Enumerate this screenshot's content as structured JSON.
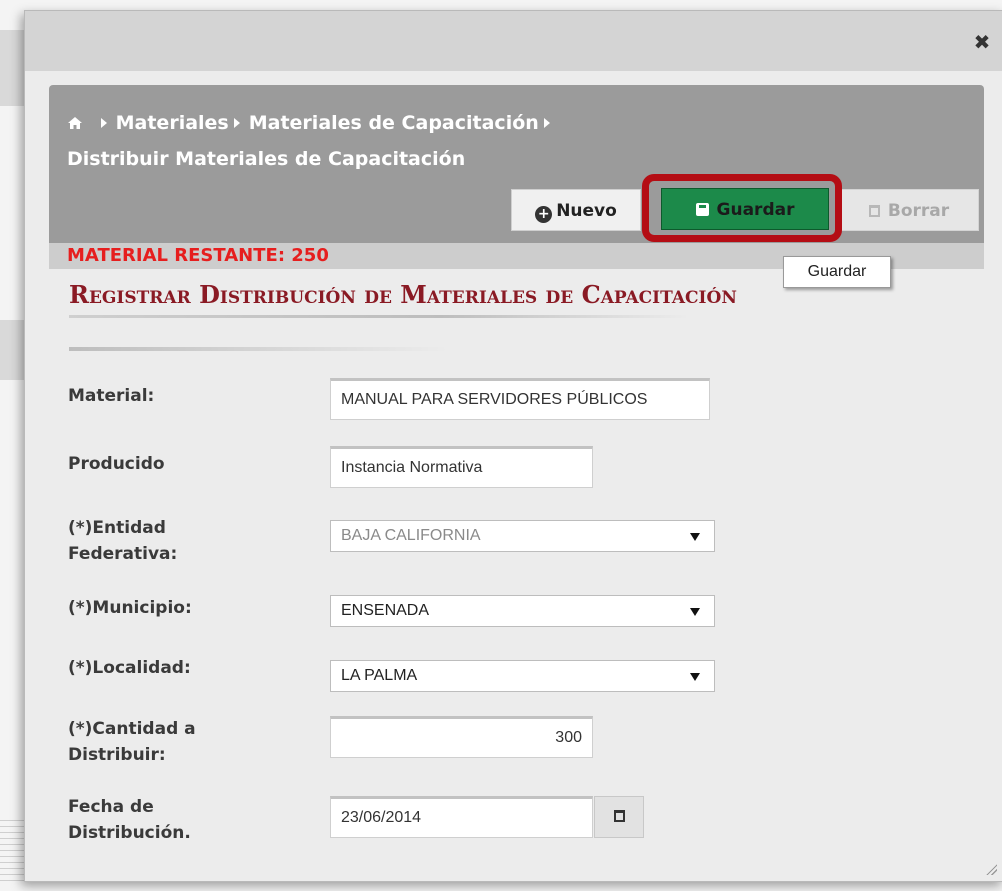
{
  "breadcrumb": {
    "items": [
      "Materiales",
      "Materiales de Capacitación"
    ],
    "current": "Distribuir Materiales de Capacitación"
  },
  "toolbar": {
    "nuevo_label": "Nuevo",
    "guardar_label": "Guardar",
    "borrar_label": "Borrar",
    "tooltip": "Guardar"
  },
  "restante": "MATERIAL RESTANTE: 250",
  "section_title": "Registrar Distribución de Materiales de Capacitación",
  "form": {
    "material": {
      "label": "Material:",
      "value": "MANUAL PARA SERVIDORES PÚBLICOS"
    },
    "producido": {
      "label": "Producido",
      "value": "Instancia Normativa"
    },
    "entidad": {
      "label": "(*)Entidad Federativa:",
      "value": "BAJA CALIFORNIA"
    },
    "municipio": {
      "label": "(*)Municipio:",
      "value": "ENSENADA"
    },
    "localidad": {
      "label": "(*)Localidad:",
      "value": "LA PALMA"
    },
    "cantidad": {
      "label": "(*)Cantidad a Distribuir:",
      "value": "300"
    },
    "fecha": {
      "label": "Fecha de Distribución.",
      "value": "23/06/2014"
    }
  },
  "icons": {
    "close": "close-icon",
    "home": "home-icon",
    "nuevo": "plus-circle-icon",
    "guardar": "save-icon",
    "borrar": "trash-icon",
    "calendar": "calendar-icon"
  },
  "colors": {
    "guardar_bg": "#1c8a4a",
    "highlight": "#b40d14",
    "restante": "#e61e1e",
    "title": "#8a1a24"
  }
}
